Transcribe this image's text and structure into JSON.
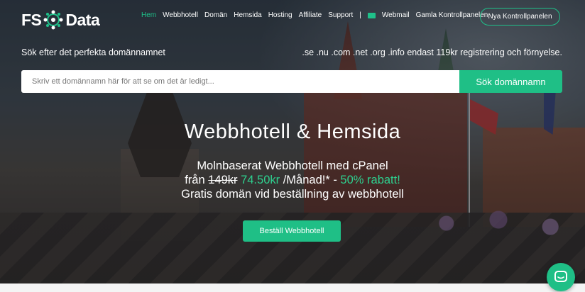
{
  "logo": {
    "text_left": "FS",
    "text_right": "Data"
  },
  "nav": {
    "items": [
      {
        "label": "Hem",
        "active": true
      },
      {
        "label": "Webbhotell"
      },
      {
        "label": "Domän"
      },
      {
        "label": "Hemsida"
      },
      {
        "label": "Hosting"
      },
      {
        "label": "Affiliate"
      },
      {
        "label": "Support"
      }
    ],
    "separator": "|",
    "mail_icon": "envelope-icon",
    "webmail": "Webmail",
    "old_panel": "Gamla Kontrollpanelen",
    "new_panel_button": "Nya Kontrollpanelen"
  },
  "search": {
    "caption": "Sök efter det perfekta domännamnet",
    "promo": ".se .nu .com .net .org .info endast 119kr registrering och förnyelse.",
    "placeholder": "Skriv ett domännamn här för att se om det är ledigt...",
    "value": "",
    "button": "Sök domännamn"
  },
  "hero": {
    "title": "Webbhotell & Hemsida",
    "line1": "Molnbaserat Webbhotell med cPanel",
    "line2_prefix": "från ",
    "old_price": "149kr",
    "new_price": " 74.50kr",
    "line2_middle": " /Månad!* - ",
    "discount": "50% rabatt!",
    "line3": "Gratis domän vid beställning av webbhotell",
    "cta": "Beställ Webbhotell"
  },
  "chat": {
    "icon": "chat-bubble-icon"
  },
  "colors": {
    "accent": "#1fbf86",
    "text": "#ffffff"
  }
}
